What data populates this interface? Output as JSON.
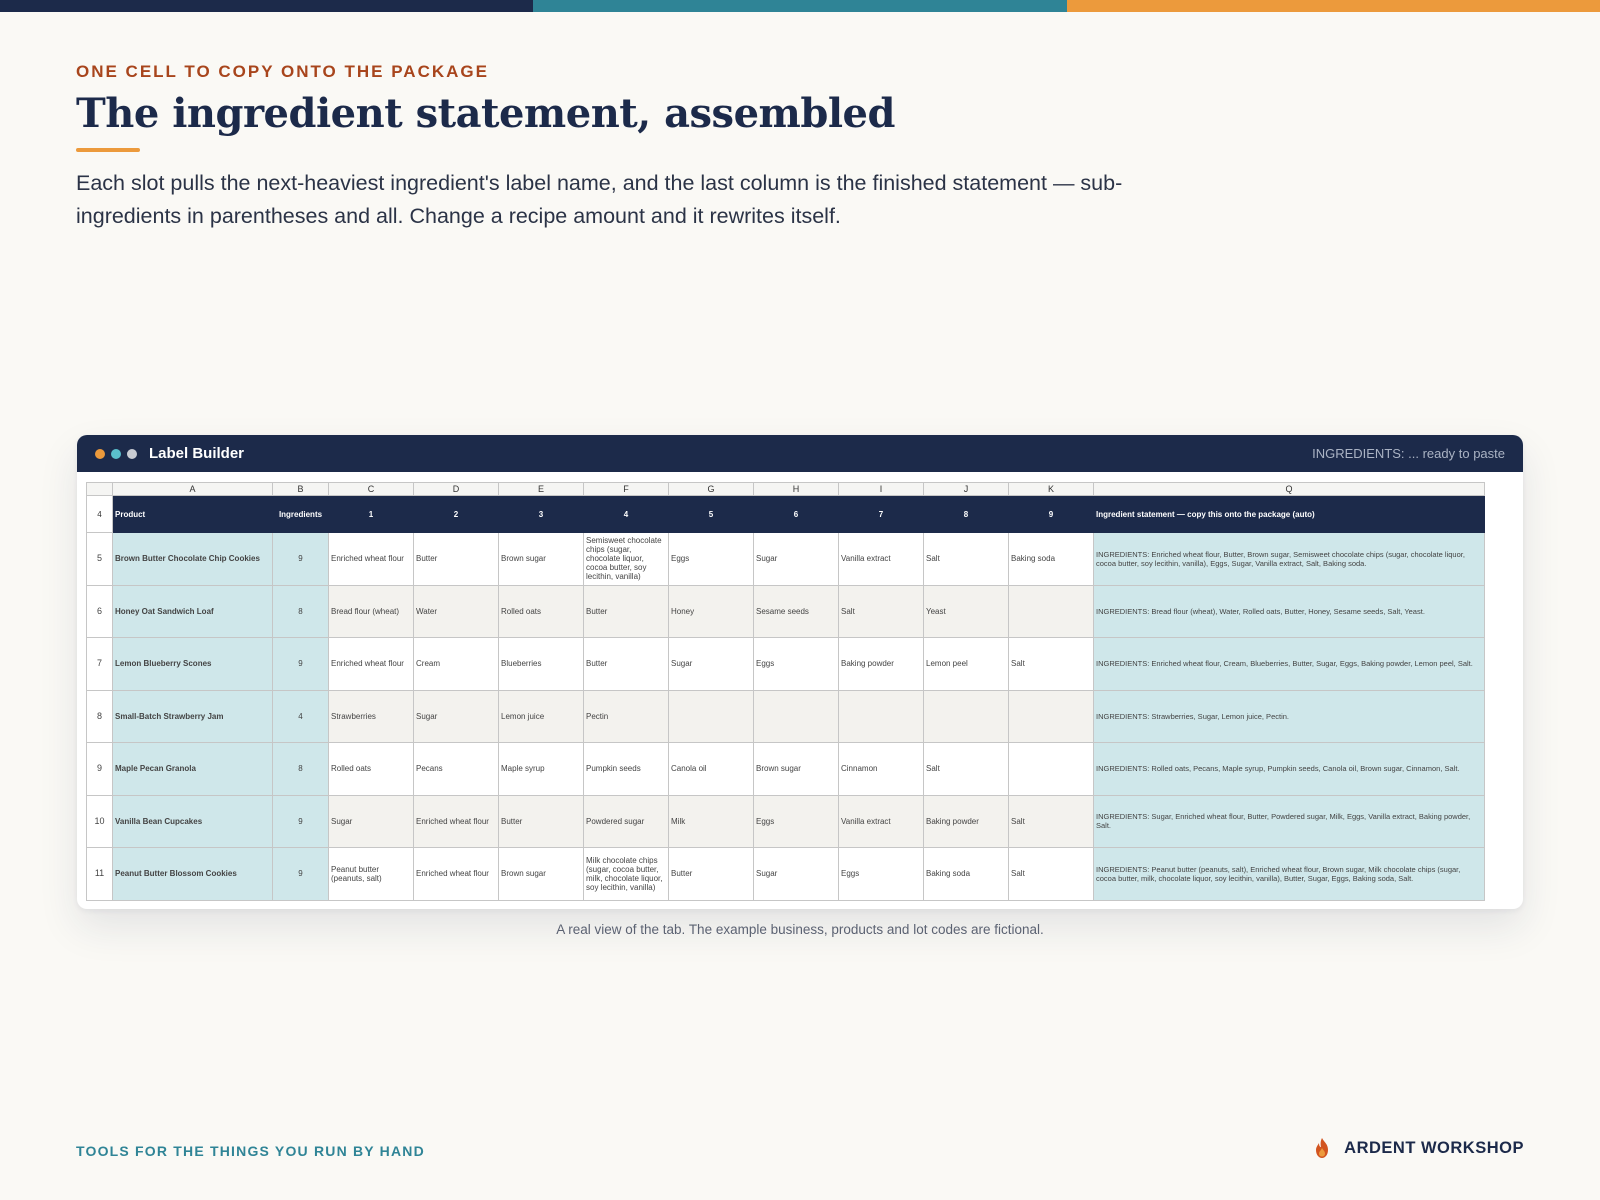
{
  "colors": {
    "navy": "#1c2a4a",
    "teal": "#2f8496",
    "orange": "#ec9a3c",
    "rust": "#a8451c",
    "cell_teal": "#cfe7ea"
  },
  "eyebrow": "ONE CELL TO COPY ONTO THE PACKAGE",
  "title": "The ingredient statement, assembled",
  "lede": "Each slot pulls the next-heaviest ingredient's label name, and the last column is the finished statement — sub-ingredients in parentheses and all. Change a recipe amount and it rewrites itself.",
  "window": {
    "title": "Label Builder",
    "status": "INGREDIENTS: ... ready to paste",
    "dots": [
      "orange-dot",
      "teal-dot",
      "gray-dot"
    ]
  },
  "sheet": {
    "columns": [
      "A",
      "B",
      "C",
      "D",
      "E",
      "F",
      "G",
      "H",
      "I",
      "J",
      "K",
      "Q"
    ],
    "header_row_number": "4",
    "headers": [
      "Product",
      "Ingredients",
      "1",
      "2",
      "3",
      "4",
      "5",
      "6",
      "7",
      "8",
      "9",
      "Ingredient statement — copy this onto the package (auto)"
    ],
    "rows": [
      {
        "num": "5",
        "product": "Brown Butter Chocolate Chip Cookies",
        "count": "9",
        "slots": [
          "Enriched wheat flour",
          "Butter",
          "Brown sugar",
          "Semisweet chocolate chips (sugar, chocolate liquor, cocoa butter, soy lecithin, vanilla)",
          "Eggs",
          "Sugar",
          "Vanilla extract",
          "Salt",
          "Baking soda"
        ],
        "statement": "INGREDIENTS: Enriched wheat flour, Butter, Brown sugar, Semisweet chocolate chips (sugar, chocolate liquor, cocoa butter, soy lecithin, vanilla), Eggs, Sugar, Vanilla extract, Salt, Baking soda."
      },
      {
        "num": "6",
        "product": "Honey Oat Sandwich Loaf",
        "count": "8",
        "slots": [
          "Bread flour (wheat)",
          "Water",
          "Rolled oats",
          "Butter",
          "Honey",
          "Sesame seeds",
          "Salt",
          "Yeast",
          ""
        ],
        "statement": "INGREDIENTS: Bread flour (wheat), Water, Rolled oats, Butter, Honey, Sesame seeds, Salt, Yeast."
      },
      {
        "num": "7",
        "product": "Lemon Blueberry Scones",
        "count": "9",
        "slots": [
          "Enriched wheat flour",
          "Cream",
          "Blueberries",
          "Butter",
          "Sugar",
          "Eggs",
          "Baking powder",
          "Lemon peel",
          "Salt"
        ],
        "statement": "INGREDIENTS: Enriched wheat flour, Cream, Blueberries, Butter, Sugar, Eggs, Baking powder, Lemon peel, Salt."
      },
      {
        "num": "8",
        "product": "Small-Batch Strawberry Jam",
        "count": "4",
        "slots": [
          "Strawberries",
          "Sugar",
          "Lemon juice",
          "Pectin",
          "",
          "",
          "",
          "",
          ""
        ],
        "statement": "INGREDIENTS: Strawberries, Sugar, Lemon juice, Pectin."
      },
      {
        "num": "9",
        "product": "Maple Pecan Granola",
        "count": "8",
        "slots": [
          "Rolled oats",
          "Pecans",
          "Maple syrup",
          "Pumpkin seeds",
          "Canola oil",
          "Brown sugar",
          "Cinnamon",
          "Salt",
          ""
        ],
        "statement": "INGREDIENTS: Rolled oats, Pecans, Maple syrup, Pumpkin seeds, Canola oil, Brown sugar, Cinnamon, Salt."
      },
      {
        "num": "10",
        "product": "Vanilla Bean Cupcakes",
        "count": "9",
        "slots": [
          "Sugar",
          "Enriched wheat flour",
          "Butter",
          "Powdered sugar",
          "Milk",
          "Eggs",
          "Vanilla extract",
          "Baking powder",
          "Salt"
        ],
        "statement": "INGREDIENTS: Sugar, Enriched wheat flour, Butter, Powdered sugar, Milk, Eggs, Vanilla extract, Baking powder, Salt."
      },
      {
        "num": "11",
        "product": "Peanut Butter Blossom Cookies",
        "count": "9",
        "slots": [
          "Peanut butter (peanuts, salt)",
          "Enriched wheat flour",
          "Brown sugar",
          "Milk chocolate chips (sugar, cocoa butter, milk, chocolate liquor, soy lecithin, vanilla)",
          "Butter",
          "Sugar",
          "Eggs",
          "Baking soda",
          "Salt"
        ],
        "statement": "INGREDIENTS: Peanut butter (peanuts, salt), Enriched wheat flour, Brown sugar, Milk chocolate chips (sugar, cocoa butter, milk, chocolate liquor, soy lecithin, vanilla), Butter, Sugar, Eggs, Baking soda, Salt."
      }
    ]
  },
  "caption": "A real view of the tab. The example business, products and lot codes are fictional.",
  "footer": {
    "tagline": "TOOLS FOR THE THINGS YOU RUN BY HAND",
    "brand_icon": "flame-icon",
    "brand": "ARDENT WORKSHOP"
  }
}
